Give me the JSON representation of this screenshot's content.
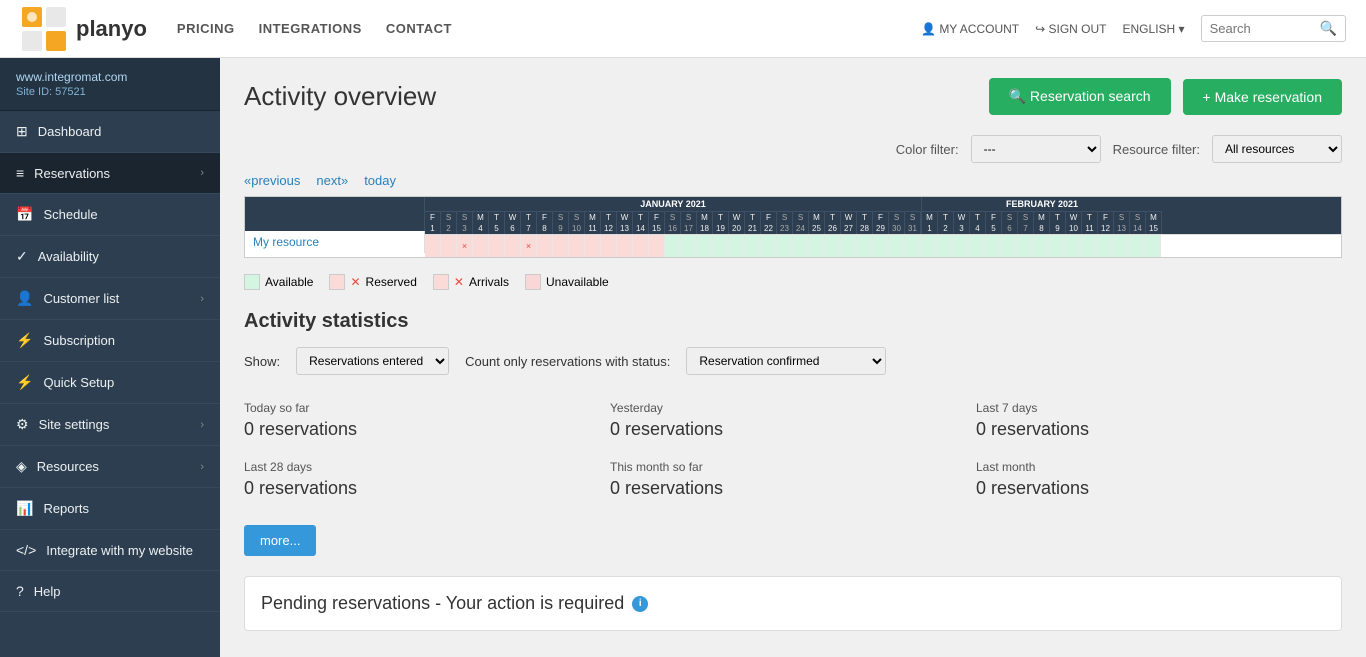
{
  "topNav": {
    "logo": "planyo",
    "links": [
      "PRICING",
      "INTEGRATIONS",
      "CONTACT"
    ],
    "account": "MY ACCOUNT",
    "signout": "SIGN OUT",
    "language": "ENGLISH",
    "search_placeholder": "Search"
  },
  "sidebar": {
    "site_url": "www.integromat.com",
    "site_id": "Site ID: 57521",
    "items": [
      {
        "id": "dashboard",
        "label": "Dashboard",
        "icon": "⊞",
        "has_arrow": false
      },
      {
        "id": "reservations",
        "label": "Reservations",
        "icon": "≡",
        "has_arrow": true
      },
      {
        "id": "schedule",
        "label": "Schedule",
        "icon": "📅",
        "has_arrow": false
      },
      {
        "id": "availability",
        "label": "Availability",
        "icon": "✓",
        "has_arrow": false
      },
      {
        "id": "customer-list",
        "label": "Customer list",
        "icon": "👤",
        "has_arrow": true
      },
      {
        "id": "subscription",
        "label": "Subscription",
        "icon": "⚡",
        "has_arrow": false
      },
      {
        "id": "quick-setup",
        "label": "Quick Setup",
        "icon": "⚡",
        "has_arrow": false
      },
      {
        "id": "site-settings",
        "label": "Site settings",
        "icon": "⚙",
        "has_arrow": true
      },
      {
        "id": "resources",
        "label": "Resources",
        "icon": "◈",
        "has_arrow": true
      },
      {
        "id": "reports",
        "label": "Reports",
        "icon": "📊",
        "has_arrow": false
      },
      {
        "id": "integrate",
        "label": "Integrate with my website",
        "icon": "</>",
        "has_arrow": false
      },
      {
        "id": "help",
        "label": "Help",
        "icon": "?",
        "has_arrow": false
      }
    ]
  },
  "page": {
    "title": "Activity overview",
    "btn_reservation_search": "Reservation search",
    "btn_make_reservation": "+ Make reservation",
    "color_filter_label": "Color filter:",
    "color_filter_default": "---",
    "resource_filter_label": "Resource filter:",
    "resource_filter_default": "All resources",
    "nav_previous": "«previous",
    "nav_next": "next»",
    "nav_today": "today"
  },
  "calendar": {
    "month1": "JANUARY 2021",
    "month2": "FEBRUARY 2021",
    "resource_name": "My resource",
    "legend": [
      {
        "type": "available",
        "label": "Available"
      },
      {
        "type": "reserved",
        "label": "Reserved"
      },
      {
        "type": "arrival",
        "label": "Arrivals"
      },
      {
        "type": "unavailable",
        "label": "Unavailable"
      }
    ]
  },
  "stats": {
    "section_title": "Activity statistics",
    "show_label": "Show:",
    "show_option": "Reservations entered",
    "count_label": "Count only reservations with status:",
    "count_option": "Reservation confirmed",
    "periods": [
      {
        "label": "Today so far",
        "value": "0 reservations"
      },
      {
        "label": "Yesterday",
        "value": "0 reservations"
      },
      {
        "label": "Last 7 days",
        "value": "0 reservations"
      },
      {
        "label": "Last 28 days",
        "value": "0 reservations"
      },
      {
        "label": "This month so far",
        "value": "0 reservations"
      },
      {
        "label": "Last month",
        "value": "0 reservations"
      }
    ],
    "more_btn": "more..."
  },
  "pending": {
    "title": "Pending reservations - Your action is required"
  }
}
